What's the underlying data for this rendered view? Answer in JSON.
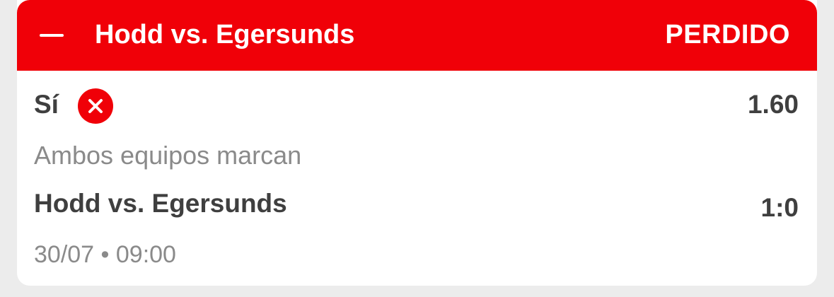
{
  "header": {
    "title": "Hodd vs. Egersunds",
    "status": "PERDIDO",
    "collapse_icon": "minus-icon",
    "color": "#f00008"
  },
  "bet": {
    "selection": "Sí",
    "result_icon": "lost-x-icon",
    "odds": "1.60",
    "market": "Ambos equipos marcan",
    "event": "Hodd vs. Egersunds",
    "score": "1:0",
    "datetime": "30/07 • 09:00"
  }
}
